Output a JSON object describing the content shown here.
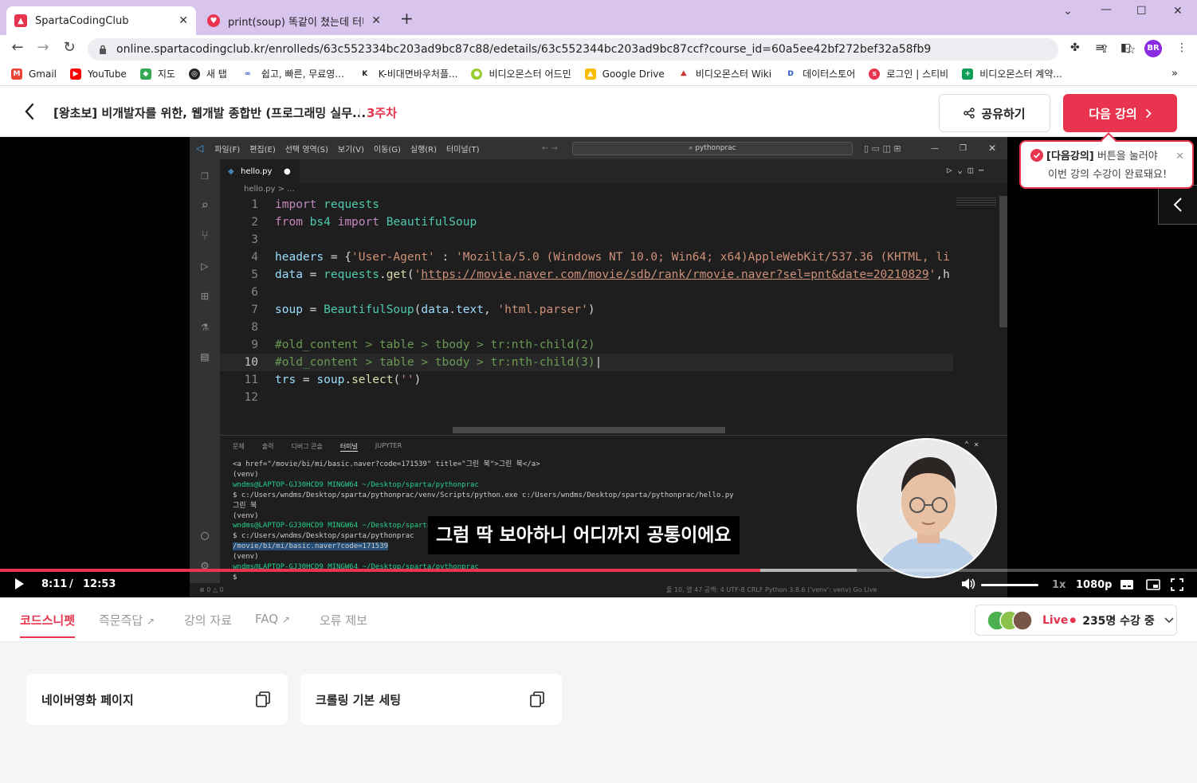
{
  "browser": {
    "tabs": [
      {
        "title": "SpartaCodingClub",
        "active": true
      },
      {
        "title": "print(soup) 똑같이 쳤는데 터미널",
        "active": false
      }
    ],
    "url": "online.spartacodingclub.kr/enrolleds/63c552334bc203ad9bc87c88/edetails/63c552344bc203ad9bc87ccf?course_id=60a5ee42bf272bef32a58fb9",
    "profile_initials": "BR",
    "bookmarks": [
      "Gmail",
      "YouTube",
      "지도",
      "새 탭",
      "쉽고, 빠른, 무료영...",
      "K-비대면바우처플...",
      "비디오몬스터 어드민",
      "Google Drive",
      "비디오몬스터 Wiki",
      "데이터스토어",
      "로그인 | 스티비",
      "비디오몬스터 계약..."
    ],
    "accent": "#d9c4ee"
  },
  "header": {
    "course_title": "[왕초보] 비개발자를 위한, 웹개발 종합반 (프로그래밍 실무...",
    "week": "3주차",
    "share_label": "공유하기",
    "next_label": "다음 강의",
    "brand_color": "#e8344e"
  },
  "tooltip": {
    "bold": "[다음강의]",
    "line1_rest": " 버튼을 눌러야",
    "line2": "이번 강의 수강이 완료돼요!"
  },
  "vscode": {
    "menu": [
      "파일(F)",
      "편집(E)",
      "선택 영역(S)",
      "보기(V)",
      "이동(G)",
      "실행(R)",
      "터미널(T)"
    ],
    "search": "pythonprac",
    "file_tab": "hello.py",
    "breadcrumb": "hello.py > ...",
    "lines": [
      {
        "n": "1",
        "code": "import requests"
      },
      {
        "n": "2",
        "code": "from bs4 import BeautifulSoup"
      },
      {
        "n": "3",
        "code": ""
      },
      {
        "n": "4",
        "code": "headers = {'User-Agent' : 'Mozilla/5.0 (Windows NT 10.0; Win64; x64)AppleWebKit/537.36 (KHTML, li"
      },
      {
        "n": "5",
        "code": "data = requests.get('https://movie.naver.com/movie/sdb/rank/rmovie.naver?sel=pnt&date=20210829',h"
      },
      {
        "n": "6",
        "code": ""
      },
      {
        "n": "7",
        "code": "soup = BeautifulSoup(data.text, 'html.parser')"
      },
      {
        "n": "8",
        "code": ""
      },
      {
        "n": "9",
        "code": "#old_content > table > tbody > tr:nth-child(2)"
      },
      {
        "n": "10",
        "code": "#old_content > table > tbody > tr:nth-child(3)"
      },
      {
        "n": "11",
        "code": "trs = soup.select('')"
      },
      {
        "n": "12",
        "code": ""
      }
    ],
    "panel_tabs": [
      "문제",
      "출력",
      "디버그 콘솔",
      "터미널",
      "JUPYTER"
    ],
    "terminal": [
      "<a href=\"/movie/bi/mi/basic.naver?code=171539\" title=\"그린 북\">그린 북</a>",
      "(venv)",
      "wndms@LAPTOP-GJ30HCD9 MINGW64 ~/Desktop/sparta/pythonprac",
      "$ c:/Users/wndms/Desktop/sparta/pythonprac/venv/Scripts/python.exe c:/Users/wndms/Desktop/sparta/pythonprac/hello.py",
      "그린 북",
      "(venv)",
      "wndms@LAPTOP-GJ30HCD9 MINGW64 ~/Desktop/sparta/pythonprac",
      "$ c:/Users/wndms/Desktop/sparta/pythonprac",
      "/movie/bi/mi/basic.naver?code=171539",
      "(venv)",
      "wndms@LAPTOP-GJ30HCD9 MINGW64 ~/Desktop/sparta/pythonprac",
      "$"
    ],
    "status_left": "⊗ 0 △ 0",
    "status_right": "줄 10, 열 47   공백: 4   UTF-8   CRLF   Python   3.8.6 ('venv': venv)   Go Live"
  },
  "video": {
    "caption": "그럼 딱 보아하니 어디까지 공통이에요",
    "current_time": "8:11",
    "separator": "/",
    "duration": "12:53",
    "speed": "1x",
    "quality": "1080p",
    "progress_fraction": 0.635
  },
  "subtabs": [
    "코드스니펫",
    "즉문즉답",
    "강의 자료",
    "FAQ",
    "오류 제보"
  ],
  "live": {
    "label": "Live",
    "count": "235명 수강 중"
  },
  "snippets": [
    "네이버영화 페이지",
    "크롤링 기본 세팅"
  ]
}
